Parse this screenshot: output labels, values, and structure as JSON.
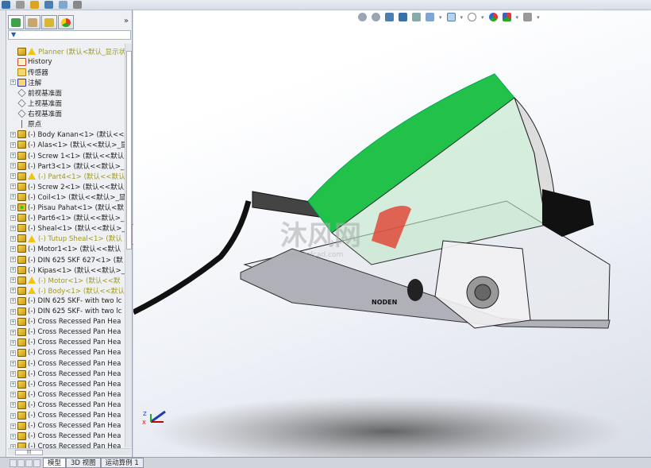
{
  "toolbar": {
    "icons": [
      "view-orientation-icon",
      "hide-show-icon",
      "section-view-icon",
      "display-style-icon",
      "appearance-icon",
      "scene-icon"
    ]
  },
  "heads_up": {
    "icons": [
      "zoom-to-fit-icon",
      "zoom-to-area-icon",
      "previous-view-icon",
      "section-view-icon",
      "dynamic-annotation-icon",
      "view-orientation-icon",
      "display-style-icon",
      "hide-show-items-icon",
      "edit-appearance-icon",
      "apply-scene-icon",
      "view-settings-icon"
    ]
  },
  "panel": {
    "more": "»",
    "filter": "▼"
  },
  "tree": [
    {
      "label": "Planner  (默认<默认_显示状态",
      "icon": "assembly",
      "warn": true,
      "exp": false
    },
    {
      "label": "History",
      "icon": "history",
      "exp": false
    },
    {
      "label": "传感器",
      "icon": "sensor",
      "exp": false
    },
    {
      "label": "注解",
      "icon": "annotation",
      "exp": true
    },
    {
      "label": "前视基准面",
      "icon": "plane",
      "exp": false
    },
    {
      "label": "上视基准面",
      "icon": "plane",
      "exp": false
    },
    {
      "label": "右视基准面",
      "icon": "plane",
      "exp": false
    },
    {
      "label": "原点",
      "icon": "origin",
      "exp": false
    },
    {
      "label": "(-) Body Kanan<1> (默认<<默",
      "icon": "part",
      "exp": true
    },
    {
      "label": "(-) Alas<1> (默认<<默认>_显",
      "icon": "part",
      "exp": true
    },
    {
      "label": "(-) Screw 1<1> (默认<<默认",
      "icon": "part",
      "exp": true
    },
    {
      "label": "(-) Part3<1> (默认<<默认>_",
      "icon": "part",
      "exp": true
    },
    {
      "label": "(-) Part4<1> (默认<<默认",
      "icon": "part",
      "warn": true,
      "exp": true
    },
    {
      "label": "(-) Screw 2<1> (默认<<默认",
      "icon": "part",
      "exp": true
    },
    {
      "label": "(-) Coil<1> (默认<<默认>_显",
      "icon": "part",
      "exp": true
    },
    {
      "label": "(-) Pisau Pahat<1> (默认<默",
      "icon": "part-green",
      "exp": true
    },
    {
      "label": "(-) Part6<1> (默认<<默认>_",
      "icon": "part",
      "exp": true
    },
    {
      "label": "(-) Sheal<1> (默认<<默认>_",
      "icon": "part",
      "exp": true
    },
    {
      "label": "(-) Tutup Sheal<1> (默认",
      "icon": "part",
      "warn": true,
      "exp": true
    },
    {
      "label": "(-) Motor1<1> (默认<<默认",
      "icon": "part",
      "exp": true
    },
    {
      "label": "(-) DIN 625 SKF 627<1> (默",
      "icon": "part",
      "exp": true
    },
    {
      "label": "(-) Kipas<1> (默认<<默认>_",
      "icon": "part",
      "exp": true
    },
    {
      "label": "(-) Motor<1> (默认<<默",
      "icon": "part",
      "warn": true,
      "exp": true
    },
    {
      "label": "(-) Body<1> (默认<<默认",
      "icon": "part",
      "warn": true,
      "exp": true
    },
    {
      "label": "(-) DIN 625 SKF- with two lc",
      "icon": "part",
      "exp": true
    },
    {
      "label": "(-) DIN 625 SKF- with two lc",
      "icon": "part",
      "exp": true
    },
    {
      "label": "(-) Cross Recessed Pan Hea",
      "icon": "part",
      "exp": true
    },
    {
      "label": "(-) Cross Recessed Pan Hea",
      "icon": "part",
      "exp": true
    },
    {
      "label": "(-) Cross Recessed Pan Hea",
      "icon": "part",
      "exp": true
    },
    {
      "label": "(-) Cross Recessed Pan Hea",
      "icon": "part",
      "exp": true
    },
    {
      "label": "(-) Cross Recessed Pan Hea",
      "icon": "part",
      "exp": true
    },
    {
      "label": "(-) Cross Recessed Pan Hea",
      "icon": "part",
      "exp": true
    },
    {
      "label": "(-) Cross Recessed Pan Hea",
      "icon": "part",
      "exp": true
    },
    {
      "label": "(-) Cross Recessed Pan Hea",
      "icon": "part",
      "exp": true
    },
    {
      "label": "(-) Cross Recessed Pan Hea",
      "icon": "part",
      "exp": true
    },
    {
      "label": "(-) Cross Recessed Pan Hea",
      "icon": "part",
      "exp": true
    },
    {
      "label": "(-) Cross Recessed Pan Hea",
      "icon": "part",
      "exp": true
    },
    {
      "label": "(-) Cross Recessed Pan Hea",
      "icon": "part",
      "exp": true
    },
    {
      "label": "(-) Cross Recessed Pan Hea",
      "icon": "part",
      "exp": true
    }
  ],
  "viewport": {
    "watermark": "沐风网",
    "watermark_url": "www.mfcad.com",
    "brand_label": "NODEN",
    "triad": {
      "z": "Z",
      "x": "X"
    }
  },
  "bottom_tabs": [
    {
      "label": "模型",
      "active": true
    },
    {
      "label": "3D 视图"
    },
    {
      "label": "运动算例 1"
    }
  ],
  "colors": {
    "warning": "#a39a1c",
    "green_part": "#22c24a",
    "accent": "#1a5fb4"
  }
}
